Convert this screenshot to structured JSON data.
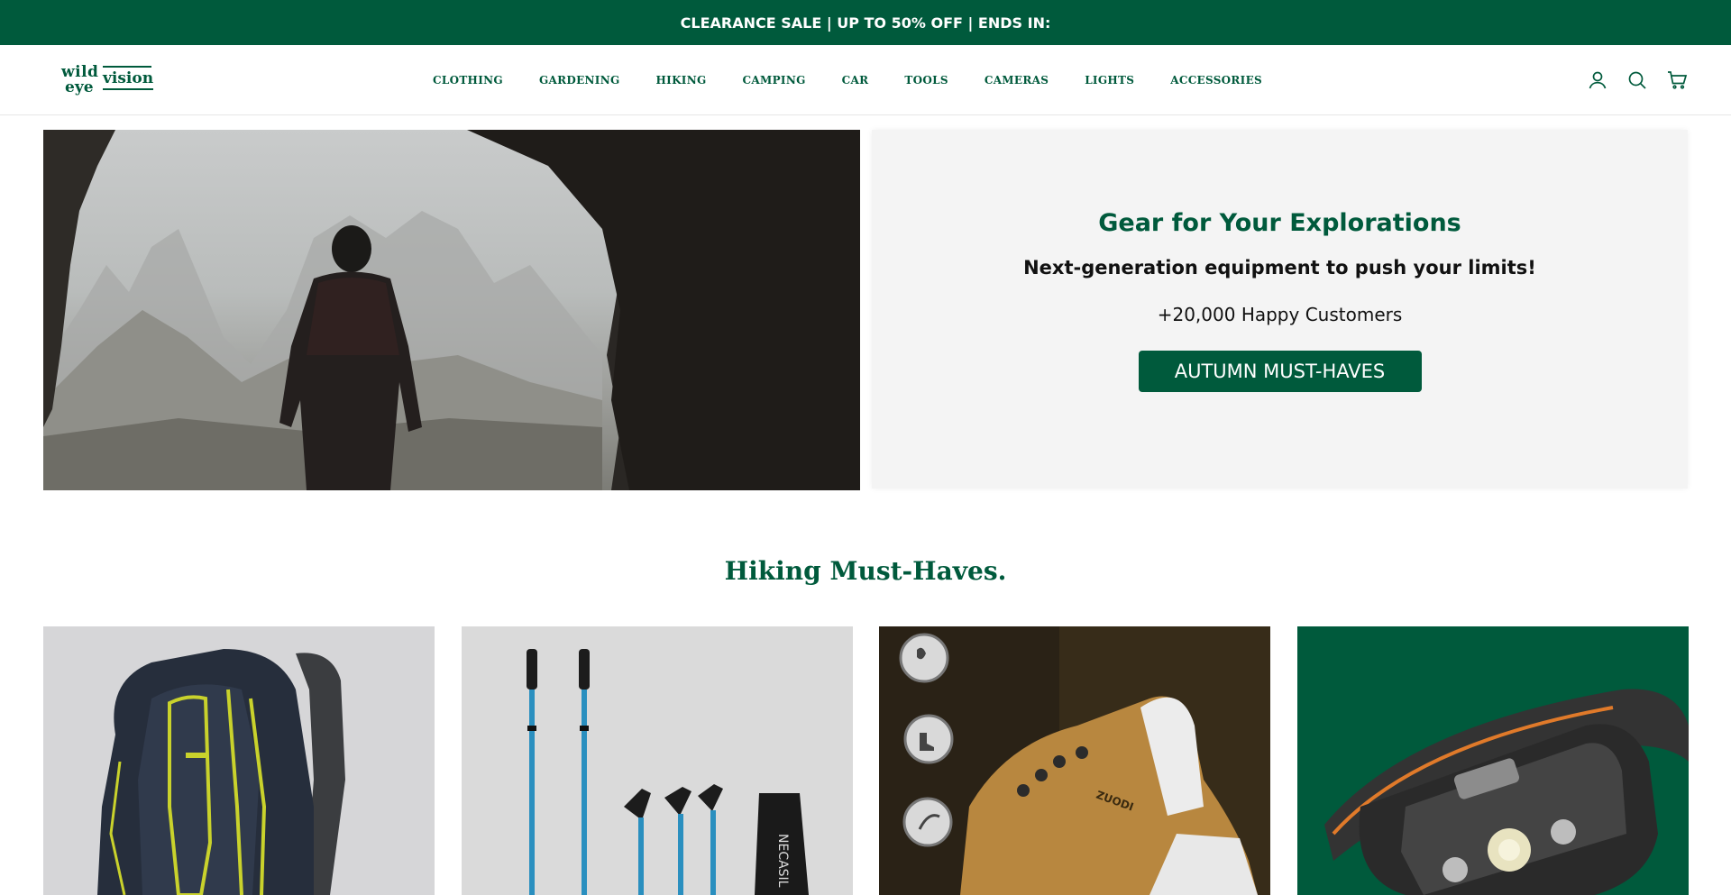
{
  "announcement": {
    "text": "CLEARANCE SALE | UP TO 50% OFF | ENDS IN:"
  },
  "brand": {
    "logo_line1": "wild",
    "logo_line2": "eye",
    "logo_line3": "vision",
    "primary_color": "#005a3c"
  },
  "nav": {
    "items": [
      {
        "label": "CLOTHING"
      },
      {
        "label": "GARDENING"
      },
      {
        "label": "HIKING"
      },
      {
        "label": "CAMPING"
      },
      {
        "label": "CAR"
      },
      {
        "label": "TOOLS"
      },
      {
        "label": "CAMERAS"
      },
      {
        "label": "LIGHTS"
      },
      {
        "label": "ACCESSORIES"
      }
    ]
  },
  "header_icons": [
    "account-icon",
    "search-icon",
    "cart-icon"
  ],
  "hero": {
    "title": "Gear for Your Explorations",
    "subtitle": "Next-generation equipment to push your limits!",
    "customers": "+20,000 Happy Customers",
    "button_label": "AUTUMN MUST-HAVES"
  },
  "section": {
    "title": "Hiking Must-Haves."
  },
  "products": [
    {
      "image": "backpack"
    },
    {
      "image": "trekking-poles",
      "brand_text": "NECASIL"
    },
    {
      "image": "hiking-shoe",
      "brand_text": "ZUODI"
    },
    {
      "image": "headlamp"
    }
  ]
}
